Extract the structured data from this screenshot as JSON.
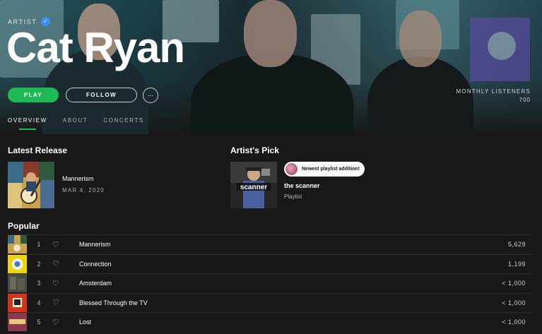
{
  "hero": {
    "tag": "ARTIST",
    "name": "Cat Ryan",
    "play_label": "PLAY",
    "follow_label": "FOLLOW",
    "more_label": "···",
    "listeners_label": "MONTHLY LISTENERS",
    "listeners_value": "700"
  },
  "tabs": [
    "OVERVIEW",
    "ABOUT",
    "CONCERTS"
  ],
  "latest_release": {
    "heading": "Latest Release",
    "title": "Mannerism",
    "date": "MAR 4, 2020"
  },
  "artist_pick": {
    "heading": "Artist's Pick",
    "note": "Newest playlist addition!",
    "title": "the scanner",
    "type": "Playlist",
    "cover_text": "scanner"
  },
  "popular": {
    "heading": "Popular",
    "tracks": [
      {
        "num": "1",
        "name": "Mannerism",
        "plays": "5,629"
      },
      {
        "num": "2",
        "name": "Connection",
        "plays": "1,199"
      },
      {
        "num": "3",
        "name": "Amsterdam",
        "plays": "< 1,000"
      },
      {
        "num": "4",
        "name": "Blessed Through the TV",
        "plays": "< 1,000"
      },
      {
        "num": "5",
        "name": "Lost",
        "plays": "< 1,000"
      }
    ]
  },
  "colors": {
    "accent": "#1db954",
    "background": "#181818",
    "verified": "#3d91f4"
  },
  "icons": [
    "verified-check-icon",
    "more-dots-icon",
    "heart-icon"
  ]
}
